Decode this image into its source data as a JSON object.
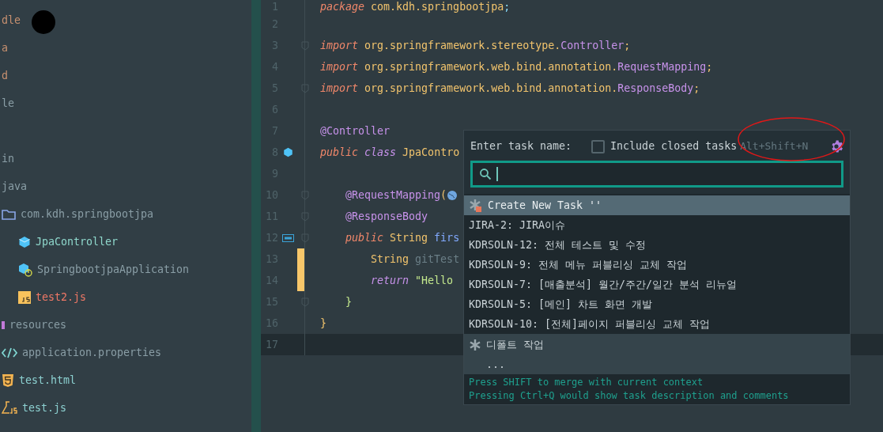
{
  "project_tree": {
    "items": [
      {
        "label": "dle",
        "kind": "plain",
        "color": "#c7906f"
      },
      {
        "label": "a",
        "kind": "plain",
        "color": "#c7906f"
      },
      {
        "label": "d",
        "kind": "plain",
        "color": "#c7906f"
      },
      {
        "label": "le",
        "kind": "plain",
        "color": "#8a9ea6"
      },
      {
        "label": "in",
        "kind": "plain",
        "color": "#8a9ea6"
      },
      {
        "label": "java",
        "kind": "plain",
        "color": "#8a9ea6"
      },
      {
        "label": "com.kdh.springbootjpa",
        "kind": "package",
        "color": "#8a9ea6",
        "children": [
          {
            "label": "JpaController",
            "kind": "class",
            "color": "#8fd8cc"
          },
          {
            "label": "SpringbootjpaApplication",
            "kind": "application",
            "color": "#8a9ea6"
          },
          {
            "label": "test2.js",
            "kind": "script",
            "color": "#f07866"
          }
        ]
      },
      {
        "label": "resources",
        "kind": "resources",
        "color": "#8a9ea6"
      },
      {
        "label": "application.properties",
        "kind": "properties",
        "color": "#8a9ea6"
      },
      {
        "label": "test.html",
        "kind": "html",
        "color": "#8cd0d0"
      },
      {
        "label": "test.js",
        "kind": "test",
        "color": "#8cd0d0"
      }
    ]
  },
  "editor": {
    "lines": [
      {
        "number": "1",
        "kind": "code",
        "tokens": [
          {
            "text": "package",
            "kind": "kw"
          },
          {
            "text": " com.kdh.springbootjpa",
            "kind": "id"
          },
          {
            "text": ";",
            "kind": "punct"
          }
        ]
      },
      {
        "number": "2",
        "kind": "code"
      },
      {
        "number": "3",
        "kind": "code",
        "fold": true,
        "tokens": [
          {
            "text": "import",
            "kind": "kw"
          },
          {
            "text": " org.springframework.stereotype.",
            "kind": "id"
          },
          {
            "text": "Controller",
            "kind": "ann"
          },
          {
            "text": ";",
            "kind": "id"
          }
        ]
      },
      {
        "number": "4",
        "kind": "code",
        "tokens": [
          {
            "text": "import",
            "kind": "kw"
          },
          {
            "text": " org.springframework.web.bind.annotation.",
            "kind": "id"
          },
          {
            "text": "RequestMapping",
            "kind": "ann"
          },
          {
            "text": ";",
            "kind": "id"
          }
        ]
      },
      {
        "number": "5",
        "kind": "code",
        "fold": true,
        "tokens": [
          {
            "text": "import",
            "kind": "kw"
          },
          {
            "text": " org.springframework.web.bind.annotation.",
            "kind": "id"
          },
          {
            "text": "ResponseBody",
            "kind": "ann"
          },
          {
            "text": ";",
            "kind": "id"
          }
        ]
      },
      {
        "number": "6",
        "kind": "code"
      },
      {
        "number": "7",
        "kind": "code",
        "tokens": [
          {
            "text": "@Controller",
            "kind": "ann"
          }
        ]
      },
      {
        "number": "8",
        "kind": "class_declaration",
        "tokens": [
          {
            "text": "public",
            "kind": "kw"
          },
          {
            "text": " class",
            "kind": "kw2"
          },
          {
            "text": " JpaContro",
            "kind": "id"
          }
        ]
      },
      {
        "number": "9",
        "kind": "code"
      },
      {
        "number": "10",
        "kind": "code",
        "fold": true,
        "tokens": [
          {
            "text": "    @RequestMapping",
            "kind": "ann"
          },
          {
            "text": "(",
            "kind": "id"
          },
          {
            "kind": "globe"
          }
        ]
      },
      {
        "number": "11",
        "kind": "code",
        "fold": true,
        "tokens": [
          {
            "text": "    @ResponseBody",
            "kind": "ann"
          }
        ]
      },
      {
        "number": "12",
        "kind": "method_declaration",
        "fold": true,
        "tokens": [
          {
            "text": "    public",
            "kind": "kw"
          },
          {
            "text": " String ",
            "kind": "id"
          },
          {
            "text": "firs",
            "kind": "fn"
          }
        ]
      },
      {
        "number": "13",
        "kind": "code",
        "changed": true,
        "tokens": [
          {
            "text": "        String ",
            "kind": "id"
          },
          {
            "text": "gitTest",
            "kind": "dim"
          }
        ]
      },
      {
        "number": "14",
        "kind": "code",
        "changed": true,
        "tokens": [
          {
            "text": "        return",
            "kind": "kw2"
          },
          {
            "text": " \"Hello",
            "kind": "str"
          }
        ]
      },
      {
        "number": "15",
        "kind": "code",
        "fold": true,
        "tokens": [
          {
            "text": "    }",
            "kind": "str"
          }
        ]
      },
      {
        "number": "16",
        "kind": "code",
        "tokens": [
          {
            "text": "}",
            "kind": "id"
          }
        ]
      },
      {
        "number": "17",
        "kind": "code",
        "current": true
      }
    ]
  },
  "task_popup": {
    "prompt": "Enter task name:",
    "include_closed": {
      "label": "Include closed tasks",
      "checked": false
    },
    "shortcut": "Alt+Shift+N",
    "items": [
      {
        "kind": "create",
        "label": "Create New Task ''",
        "selected": true
      },
      {
        "kind": "issue",
        "label": "JIRA-2: JIRA이슈",
        "selected": false
      },
      {
        "kind": "issue",
        "label": "KDRSOLN-12: 전체 테스트 및 수정",
        "selected": false
      },
      {
        "kind": "issue",
        "label": "KDRSOLN-9: 전체 메뉴 퍼블리싱 교체 작업",
        "selected": false
      },
      {
        "kind": "issue",
        "label": "KDRSOLN-7: [매출분석] 월간/주간/일간 분석 리뉴얼",
        "selected": false
      },
      {
        "kind": "issue",
        "label": "KDRSOLN-5: [메인] 차트 화면 개발",
        "selected": false
      },
      {
        "kind": "issue",
        "label": "KDRSOLN-10: [전체]페이지 퍼블리싱 교체 작업",
        "selected": false
      },
      {
        "kind": "local",
        "label": "디폴트 작업",
        "selected": false
      },
      {
        "kind": "more",
        "label": "...",
        "selected": false
      }
    ],
    "hints": [
      "Press SHIFT to merge with current context",
      "Pressing Ctrl+Q would show task description and comments"
    ]
  }
}
